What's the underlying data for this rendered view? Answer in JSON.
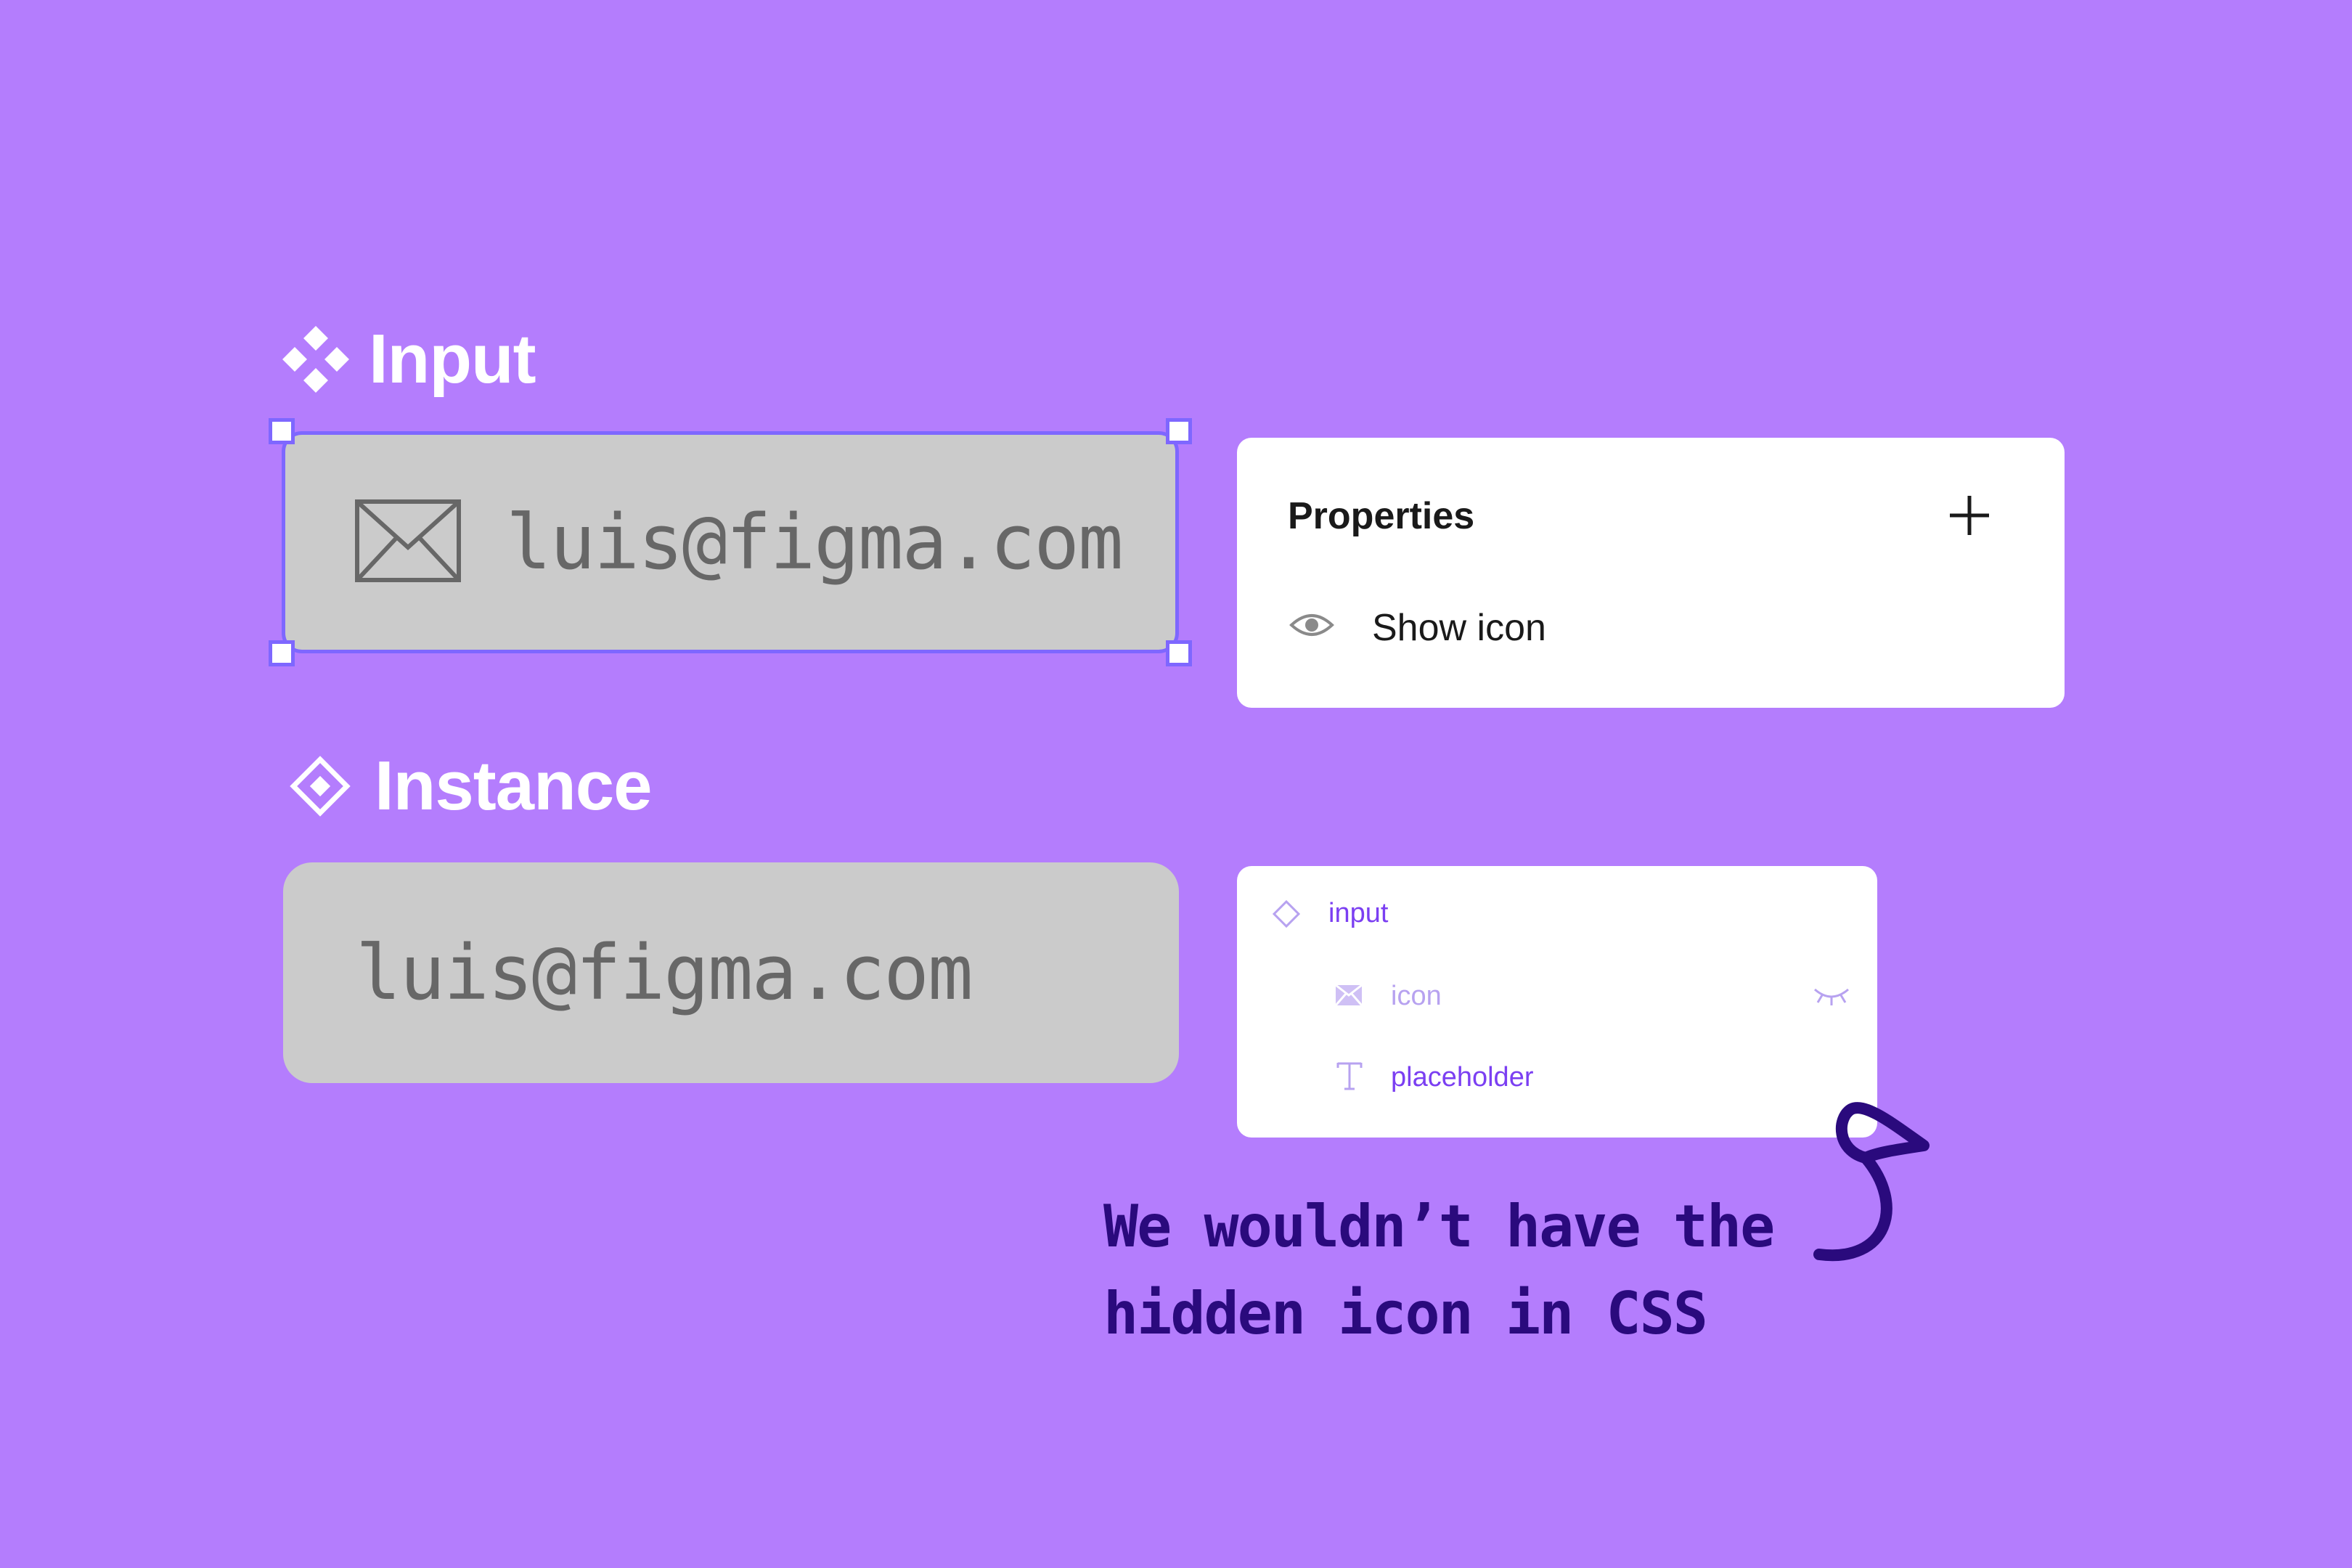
{
  "colors": {
    "background": "#b47dfd",
    "selection": "#7e67ff",
    "input_fill": "#cbcbcb",
    "input_text": "#676767",
    "layer_active": "#7b3ff2",
    "layer_hidden": "#b7a2f0",
    "note": "#2a0a7d"
  },
  "component": {
    "title": "Input",
    "title_icon": "component-icon",
    "field_icon": "envelope-icon",
    "field_value": "luis@figma.com"
  },
  "instance": {
    "title": "Instance",
    "title_icon": "instance-icon",
    "field_value": "luis@figma.com"
  },
  "properties_panel": {
    "title": "Properties",
    "add_icon": "plus-icon",
    "rows": [
      {
        "icon": "eye-icon",
        "label": "Show icon"
      }
    ]
  },
  "layers_panel": {
    "items": [
      {
        "icon": "instance-icon",
        "label": "input",
        "state": "visible"
      },
      {
        "icon": "image-icon",
        "label": "icon",
        "state": "hidden",
        "visibility_icon": "eye-closed-icon"
      },
      {
        "icon": "text-icon",
        "label": "placeholder",
        "state": "visible"
      }
    ]
  },
  "note": {
    "line1": "We wouldn’t have the",
    "line2": "hidden icon in CSS"
  }
}
